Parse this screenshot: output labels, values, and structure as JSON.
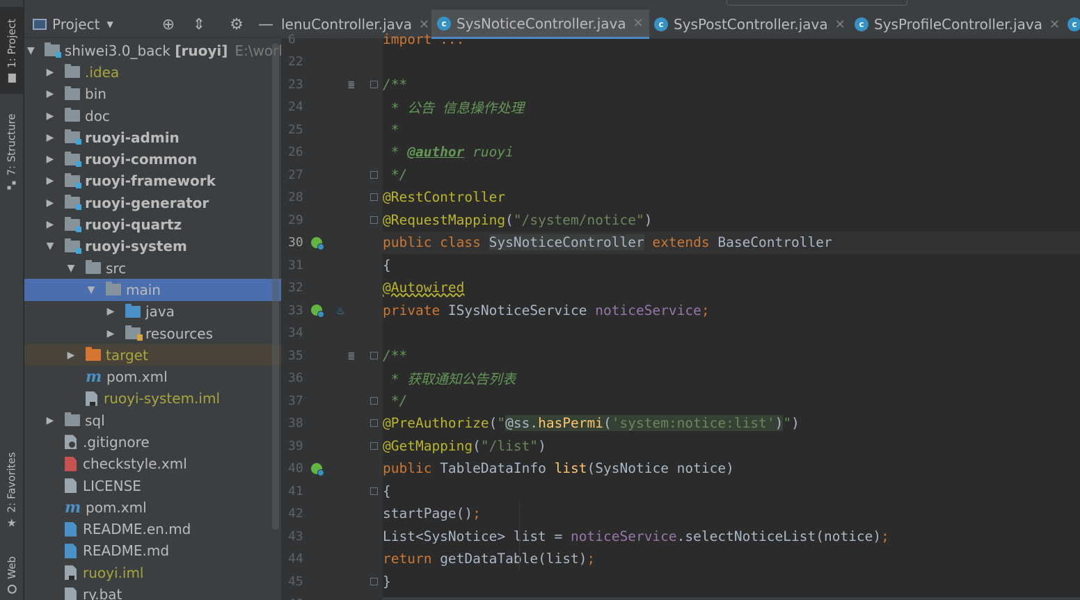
{
  "tool_strip": {
    "project_tab": "1: Project",
    "structure_tab": "7: Structure",
    "favorites_tab": "2: Favorites",
    "web_tab": "Web"
  },
  "project_panel": {
    "title": "Project",
    "tree": [
      {
        "label": "shiwei3.0_back",
        "module": "[ruoyi]",
        "path": "E:\\work",
        "expanded": true,
        "depth": 0,
        "icon": "module-folder-icon"
      },
      {
        "label": ".idea",
        "depth": 1,
        "icon": "folder-icon",
        "style": "yellow"
      },
      {
        "label": "bin",
        "depth": 1,
        "icon": "folder-icon"
      },
      {
        "label": "doc",
        "depth": 1,
        "icon": "folder-icon"
      },
      {
        "label": "ruoyi-admin",
        "depth": 1,
        "icon": "module-folder-icon",
        "style": "bold"
      },
      {
        "label": "ruoyi-common",
        "depth": 1,
        "icon": "module-folder-icon",
        "style": "bold"
      },
      {
        "label": "ruoyi-framework",
        "depth": 1,
        "icon": "module-folder-icon",
        "style": "bold"
      },
      {
        "label": "ruoyi-generator",
        "depth": 1,
        "icon": "module-folder-icon",
        "style": "bold"
      },
      {
        "label": "ruoyi-quartz",
        "depth": 1,
        "icon": "module-folder-icon",
        "style": "bold"
      },
      {
        "label": "ruoyi-system",
        "depth": 1,
        "icon": "module-folder-icon",
        "style": "bold",
        "expanded": true
      },
      {
        "label": "src",
        "depth": 2,
        "icon": "folder-icon",
        "expanded": true
      },
      {
        "label": "main",
        "depth": 3,
        "icon": "folder-icon",
        "expanded": true,
        "selected": true
      },
      {
        "label": "java",
        "depth": 4,
        "icon": "source-folder-icon"
      },
      {
        "label": "resources",
        "depth": 4,
        "icon": "resources-folder-icon"
      },
      {
        "label": "target",
        "depth": 2,
        "icon": "excluded-folder-icon",
        "style": "yellow"
      },
      {
        "label": "pom.xml",
        "depth": 2,
        "icon": "maven-icon",
        "leaf": true
      },
      {
        "label": "ruoyi-system.iml",
        "depth": 2,
        "icon": "iml-file-icon",
        "style": "yellow",
        "leaf": true
      },
      {
        "label": "sql",
        "depth": 1,
        "icon": "folder-icon"
      },
      {
        "label": ".gitignore",
        "depth": 1,
        "icon": "gitignore-file-icon",
        "leaf": true
      },
      {
        "label": "checkstyle.xml",
        "depth": 1,
        "icon": "xml-file-icon",
        "leaf": true
      },
      {
        "label": "LICENSE",
        "depth": 1,
        "icon": "text-file-icon",
        "leaf": true
      },
      {
        "label": "pom.xml",
        "depth": 1,
        "icon": "maven-icon",
        "leaf": true
      },
      {
        "label": "README.en.md",
        "depth": 1,
        "icon": "markdown-file-icon",
        "leaf": true
      },
      {
        "label": "README.md",
        "depth": 1,
        "icon": "markdown-file-icon",
        "leaf": true
      },
      {
        "label": "ruoyi.iml",
        "depth": 1,
        "icon": "iml-file-icon",
        "style": "yellow",
        "leaf": true
      },
      {
        "label": "ry.bat",
        "depth": 1,
        "icon": "bat-file-icon",
        "leaf": true
      }
    ]
  },
  "tabs": [
    {
      "label": "MenuController.java",
      "display": "lenuController.java",
      "active": false
    },
    {
      "label": "SysNoticeController.java",
      "active": true
    },
    {
      "label": "SysPostController.java",
      "active": false
    },
    {
      "label": "SysProfileController.java",
      "active": false
    }
  ],
  "editor": {
    "line_numbers": [
      "6",
      "22",
      "23",
      "24",
      "25",
      "26",
      "27",
      "28",
      "29",
      "30",
      "31",
      "32",
      "33",
      "34",
      "35",
      "36",
      "37",
      "38",
      "39",
      "40",
      "41",
      "42",
      "43",
      "44",
      "45",
      "46"
    ],
    "current_line": "30",
    "code": {
      "l6_import": "import ...",
      "l23_open": "/**",
      "l24_cmt": " * 公告 信息操作处理",
      "l25_cmt": " *",
      "l26_star": " * ",
      "l26_tag": "@author",
      "l26_name": " ruoyi",
      "l27_close": " */",
      "l28_ann": "@RestController",
      "l29_ann": "@RequestMapping",
      "l29_str": "\"/system/notice\"",
      "l30_public": "public class ",
      "l30_class": "SysNoticeController",
      "l30_extends": " extends ",
      "l30_base": "BaseController",
      "l31": "{",
      "l32_ann": "@Autowired",
      "l33_private": "private ",
      "l33_type": "ISysNoticeService ",
      "l33_field": "noticeService",
      "l35_open": "/**",
      "l36_cmt": " * 获取通知公告列表",
      "l37_close": " */",
      "l38_ann": "@PreAuthorize",
      "l38_q1": "\"",
      "l38_ss": "@ss.",
      "l38_method": "hasPermi",
      "l38_arg": "'system:notice:list'",
      "l38_q2": "\"",
      "l39_ann": "@GetMapping",
      "l39_str": "\"/list\"",
      "l40_public": "public ",
      "l40_type": "TableDataInfo ",
      "l40_method": "list",
      "l40_params": "(SysNotice notice)",
      "l41": "{",
      "l42_call": "startPage()",
      "l43_decl": "List<SysNotice> list = ",
      "l43_field": "noticeService",
      "l43_call": ".selectNoticeList(notice)",
      "l44_return": "return ",
      "l44_call": "getDataTable(list)",
      "l45": "}"
    }
  }
}
